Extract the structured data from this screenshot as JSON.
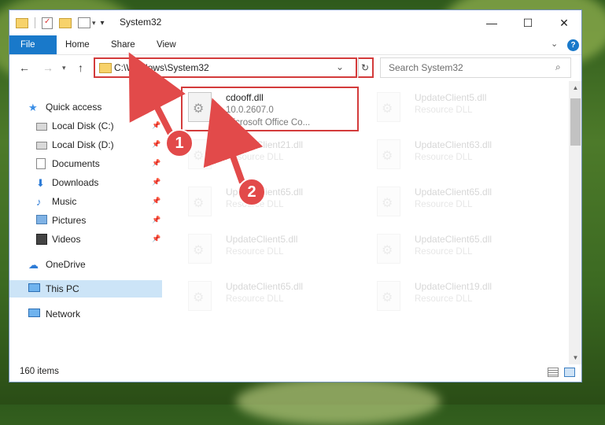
{
  "window": {
    "title": "System32",
    "controls": {
      "minimize": "—",
      "maximize": "☐",
      "close": "✕"
    }
  },
  "ribbon": {
    "tabs": [
      "File",
      "Home",
      "Share",
      "View"
    ],
    "expand_icon": "chevron-down-icon",
    "help_label": "?"
  },
  "navbar": {
    "address_value": "C:\\Windows\\System32",
    "search_placeholder": "Search System32"
  },
  "sidebar": {
    "items": [
      {
        "label": "Quick access",
        "icon": "star-icon",
        "pinned": false
      },
      {
        "label": "Local Disk (C:)",
        "icon": "drive-icon",
        "pinned": true
      },
      {
        "label": "Local Disk (D:)",
        "icon": "drive-icon",
        "pinned": true
      },
      {
        "label": "Documents",
        "icon": "document-icon",
        "pinned": true
      },
      {
        "label": "Downloads",
        "icon": "download-icon",
        "pinned": true
      },
      {
        "label": "Music",
        "icon": "music-icon",
        "pinned": true
      },
      {
        "label": "Pictures",
        "icon": "picture-icon",
        "pinned": true
      },
      {
        "label": "Videos",
        "icon": "video-icon",
        "pinned": true
      },
      {
        "label": "OneDrive",
        "icon": "cloud-icon",
        "pinned": false
      },
      {
        "label": "This PC",
        "icon": "computer-icon",
        "pinned": false,
        "selected": true
      },
      {
        "label": "Network",
        "icon": "network-icon",
        "pinned": false
      }
    ]
  },
  "files": [
    {
      "name": "cdooff.dll",
      "line2": "10.0.2607.0",
      "line3": "Microsoft Office Co...",
      "highlighted": true
    },
    {
      "name": "UpdateClient5.dll",
      "line2": "Resource DLL"
    },
    {
      "name": "UpdateClient21.dll",
      "line2": "Resource DLL"
    },
    {
      "name": "UpdateClient63.dll",
      "line2": "Resource DLL"
    },
    {
      "name": "UpdateClient65.dll",
      "line2": "Resource DLL"
    },
    {
      "name": "UpdateClient65.dll",
      "line2": "Resource DLL"
    },
    {
      "name": "UpdateClient5.dll",
      "line2": "Resource DLL"
    },
    {
      "name": "UpdateClient65.dll",
      "line2": "Resource DLL"
    },
    {
      "name": "UpdateClient65.dll",
      "line2": "Resource DLL"
    },
    {
      "name": "UpdateClient19.dll",
      "line2": "Resource DLL"
    }
  ],
  "status": {
    "item_count": "160 items"
  },
  "annotations": {
    "marker1": "1",
    "marker2": "2"
  },
  "colors": {
    "accent": "#1979ca",
    "highlight": "#d33b3b",
    "selected": "#cce4f7"
  }
}
